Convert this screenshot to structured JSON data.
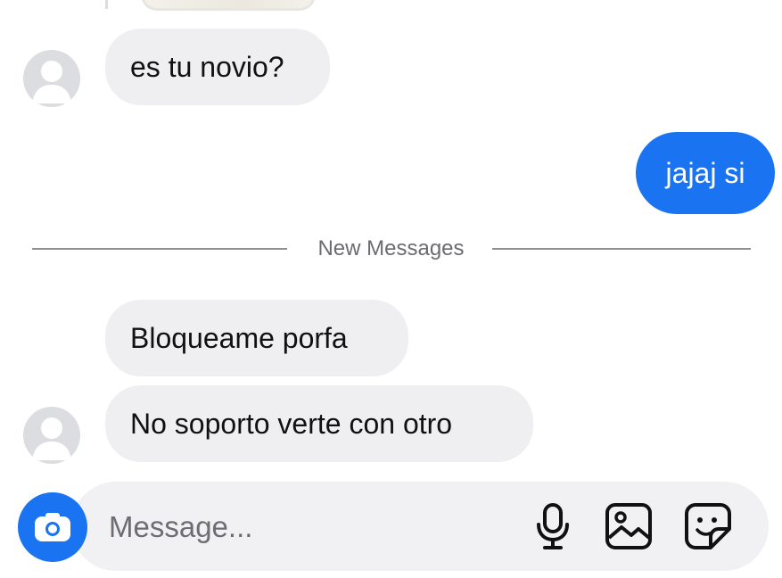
{
  "conversation": {
    "messages": [
      {
        "sender": "them",
        "text": "es tu novio?"
      },
      {
        "sender": "me",
        "text": "jajaj si"
      },
      {
        "sender": "them",
        "text": "Bloqueame porfa"
      },
      {
        "sender": "them",
        "text": "No soporto verte con otro"
      }
    ],
    "divider_label": "New Messages"
  },
  "composer": {
    "placeholder": "Message...",
    "value": "",
    "icons": {
      "camera": "camera-icon",
      "mic": "microphone-icon",
      "gallery": "gallery-icon",
      "sticker": "sticker-icon"
    }
  },
  "colors": {
    "accent": "#1a73f0",
    "incoming_bubble": "#efeff1",
    "divider": "#8e8e93"
  }
}
